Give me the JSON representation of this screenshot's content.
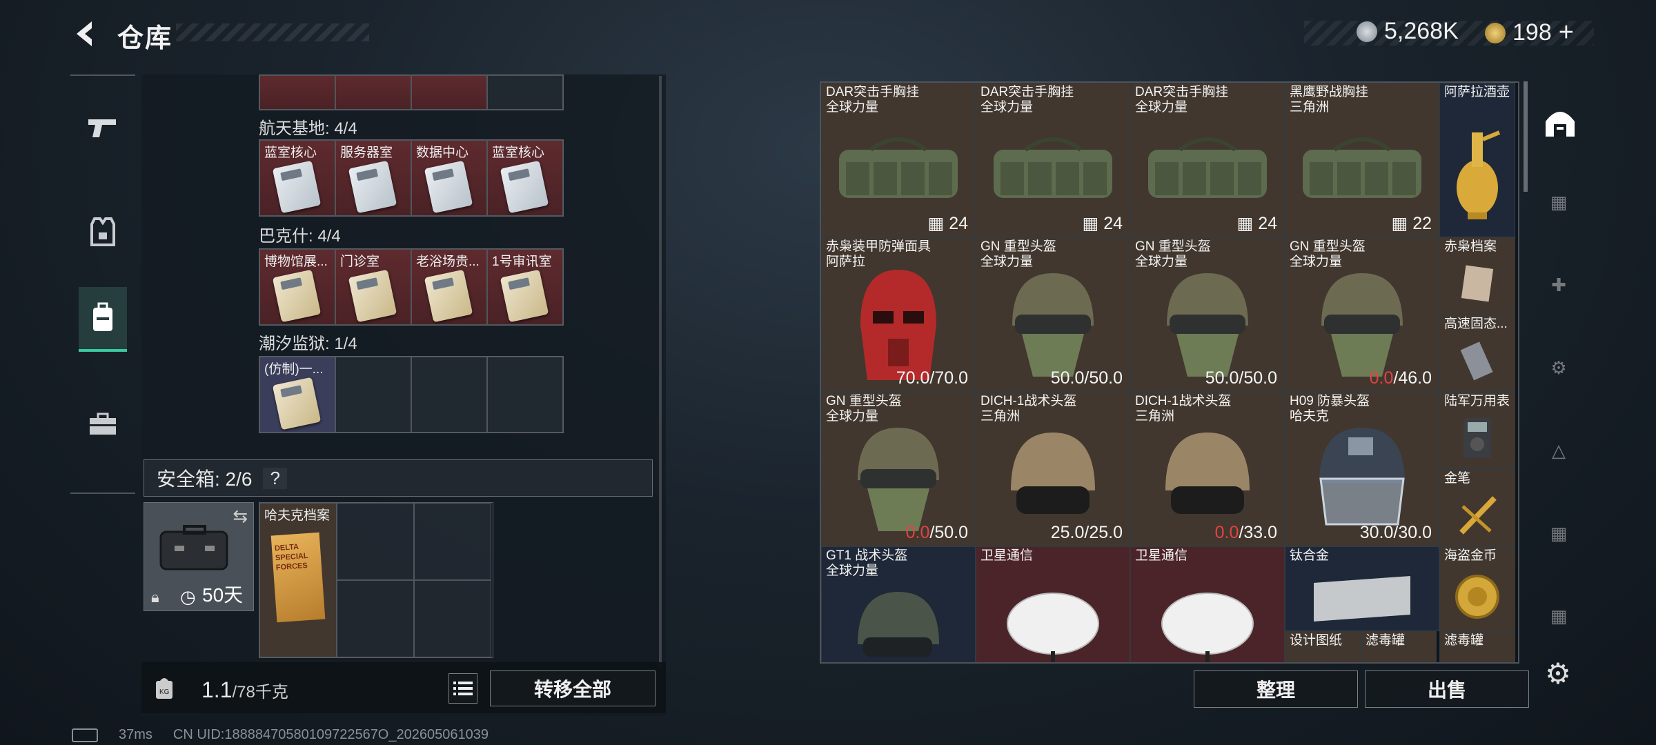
{
  "header": {
    "title": "仓库",
    "currency": {
      "coin_value": "5,268K",
      "gold_value": "198",
      "gold_add": "+"
    }
  },
  "left_nav": [
    "weapon",
    "armor",
    "backpack",
    "toolbox"
  ],
  "keys_top_partial": [
    "",
    "",
    "",
    ""
  ],
  "sections": [
    {
      "title": "航天基地: 4/4",
      "cells": [
        {
          "label": "蓝室核心",
          "filled": true
        },
        {
          "label": "服务器室",
          "filled": true
        },
        {
          "label": "数据中心",
          "filled": true
        },
        {
          "label": "蓝室核心",
          "filled": true
        }
      ]
    },
    {
      "title": "巴克什: 4/4",
      "cells": [
        {
          "label": "博物馆展...",
          "filled": true
        },
        {
          "label": "门诊室",
          "filled": true
        },
        {
          "label": "老浴场贵...",
          "filled": true
        },
        {
          "label": "1号审讯室",
          "filled": true
        }
      ]
    },
    {
      "title": "潮汐监狱: 1/4",
      "cells": [
        {
          "label": "(仿制)一...",
          "filled": true
        },
        {
          "label": "",
          "filled": false
        },
        {
          "label": "",
          "filled": false
        },
        {
          "label": "",
          "filled": false
        }
      ]
    }
  ],
  "safe_box": {
    "title": "安全箱: 2/6",
    "help": "?",
    "duration": "50天",
    "item_label": "哈夫克档案",
    "doc_text": "DELTA SPECIAL FORCES"
  },
  "weight": {
    "current": "1.1",
    "max": "/78千克"
  },
  "buttons": {
    "transfer_all": "转移全部",
    "organize": "整理",
    "sell": "出售"
  },
  "items": [
    {
      "name": "DAR突击手胸挂",
      "sub": "全球力量",
      "value": "24",
      "bg": "brown"
    },
    {
      "name": "DAR突击手胸挂",
      "sub": "全球力量",
      "value": "24",
      "bg": "brown"
    },
    {
      "name": "DAR突击手胸挂",
      "sub": "全球力量",
      "value": "24",
      "bg": "brown"
    },
    {
      "name": "黑鹰野战胸挂",
      "sub": "三角洲",
      "value": "22",
      "bg": "brown"
    },
    {
      "name": "阿萨拉酒壶",
      "sub": "",
      "value": "",
      "bg": "blue"
    },
    {
      "name": "赤枭装甲防弹面具",
      "sub": "阿萨拉",
      "val_a": "70.0",
      "val_b": "/70.0",
      "bg": "brown"
    },
    {
      "name": "GN 重型头盔",
      "sub": "全球力量",
      "val_a": "50.0",
      "val_b": "/50.0",
      "bg": "brown"
    },
    {
      "name": "GN 重型头盔",
      "sub": "全球力量",
      "val_a": "50.0",
      "val_b": "/50.0",
      "bg": "brown"
    },
    {
      "name": "GN 重型头盔",
      "sub": "全球力量",
      "val_a": "0.0",
      "val_b": "/46.0",
      "bg": "brown"
    },
    {
      "name": "赤枭档案",
      "sub": "",
      "bg": "brown"
    },
    {
      "name": "高速固态...",
      "sub": "",
      "bg": "brown"
    },
    {
      "name": "GN 重型头盔",
      "sub": "全球力量",
      "val_a": "0.0",
      "val_b": "/50.0",
      "bg": "brown"
    },
    {
      "name": "DICH-1战术头盔",
      "sub": "三角洲",
      "val_a": "25.0",
      "val_b": "/25.0",
      "bg": "brown"
    },
    {
      "name": "DICH-1战术头盔",
      "sub": "三角洲",
      "val_a": "0.0",
      "val_b": "/33.0",
      "bg": "brown"
    },
    {
      "name": "H09 防暴头盔",
      "sub": "哈夫克",
      "val_a": "30.0",
      "val_b": "/30.0",
      "bg": "brown"
    },
    {
      "name": "陆军万用表",
      "sub": "",
      "bg": "brown"
    },
    {
      "name": "金笔",
      "sub": "",
      "bg": "brown"
    },
    {
      "name": "GT1 战术头盔",
      "sub": "全球力量",
      "bg": "blue"
    },
    {
      "name": "卫星通信",
      "sub": "",
      "bg": "red"
    },
    {
      "name": "卫星通信",
      "sub": "",
      "bg": "red"
    },
    {
      "name": "钛合金",
      "sub": "",
      "bg": "blue"
    },
    {
      "name": "海盗金币",
      "sub": "",
      "bg": "brown"
    },
    {
      "name": "设计图纸",
      "sub": "",
      "bg": "brown"
    },
    {
      "name": "滤毒罐",
      "sub": "",
      "bg": "brown"
    },
    {
      "name": "滤毒罐",
      "sub": "",
      "bg": "brown"
    }
  ],
  "status": {
    "ping": "37ms",
    "uid": "CN UID:18888470580109722567O_202605061039"
  }
}
